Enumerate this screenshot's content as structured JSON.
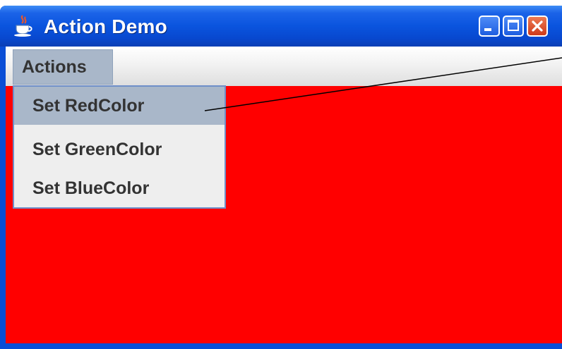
{
  "window": {
    "title": "Action Demo",
    "icon": "java-cup-icon",
    "controls": [
      "minimize-icon",
      "maximize-icon",
      "close-icon"
    ]
  },
  "menubar": {
    "menus": [
      {
        "label": "Actions",
        "open": true
      }
    ]
  },
  "popup": {
    "items": [
      {
        "label": "Set RedColor",
        "selected": true
      },
      {
        "label": "Set GreenColor",
        "selected": false
      },
      {
        "label": "Set BlueColor",
        "selected": false
      }
    ]
  },
  "content": {
    "background_color": "#ff0000"
  },
  "colors": {
    "titlebar": "#0a54de",
    "menu_highlight": "#a9b7c9",
    "close_button": "#cd3a1a"
  }
}
